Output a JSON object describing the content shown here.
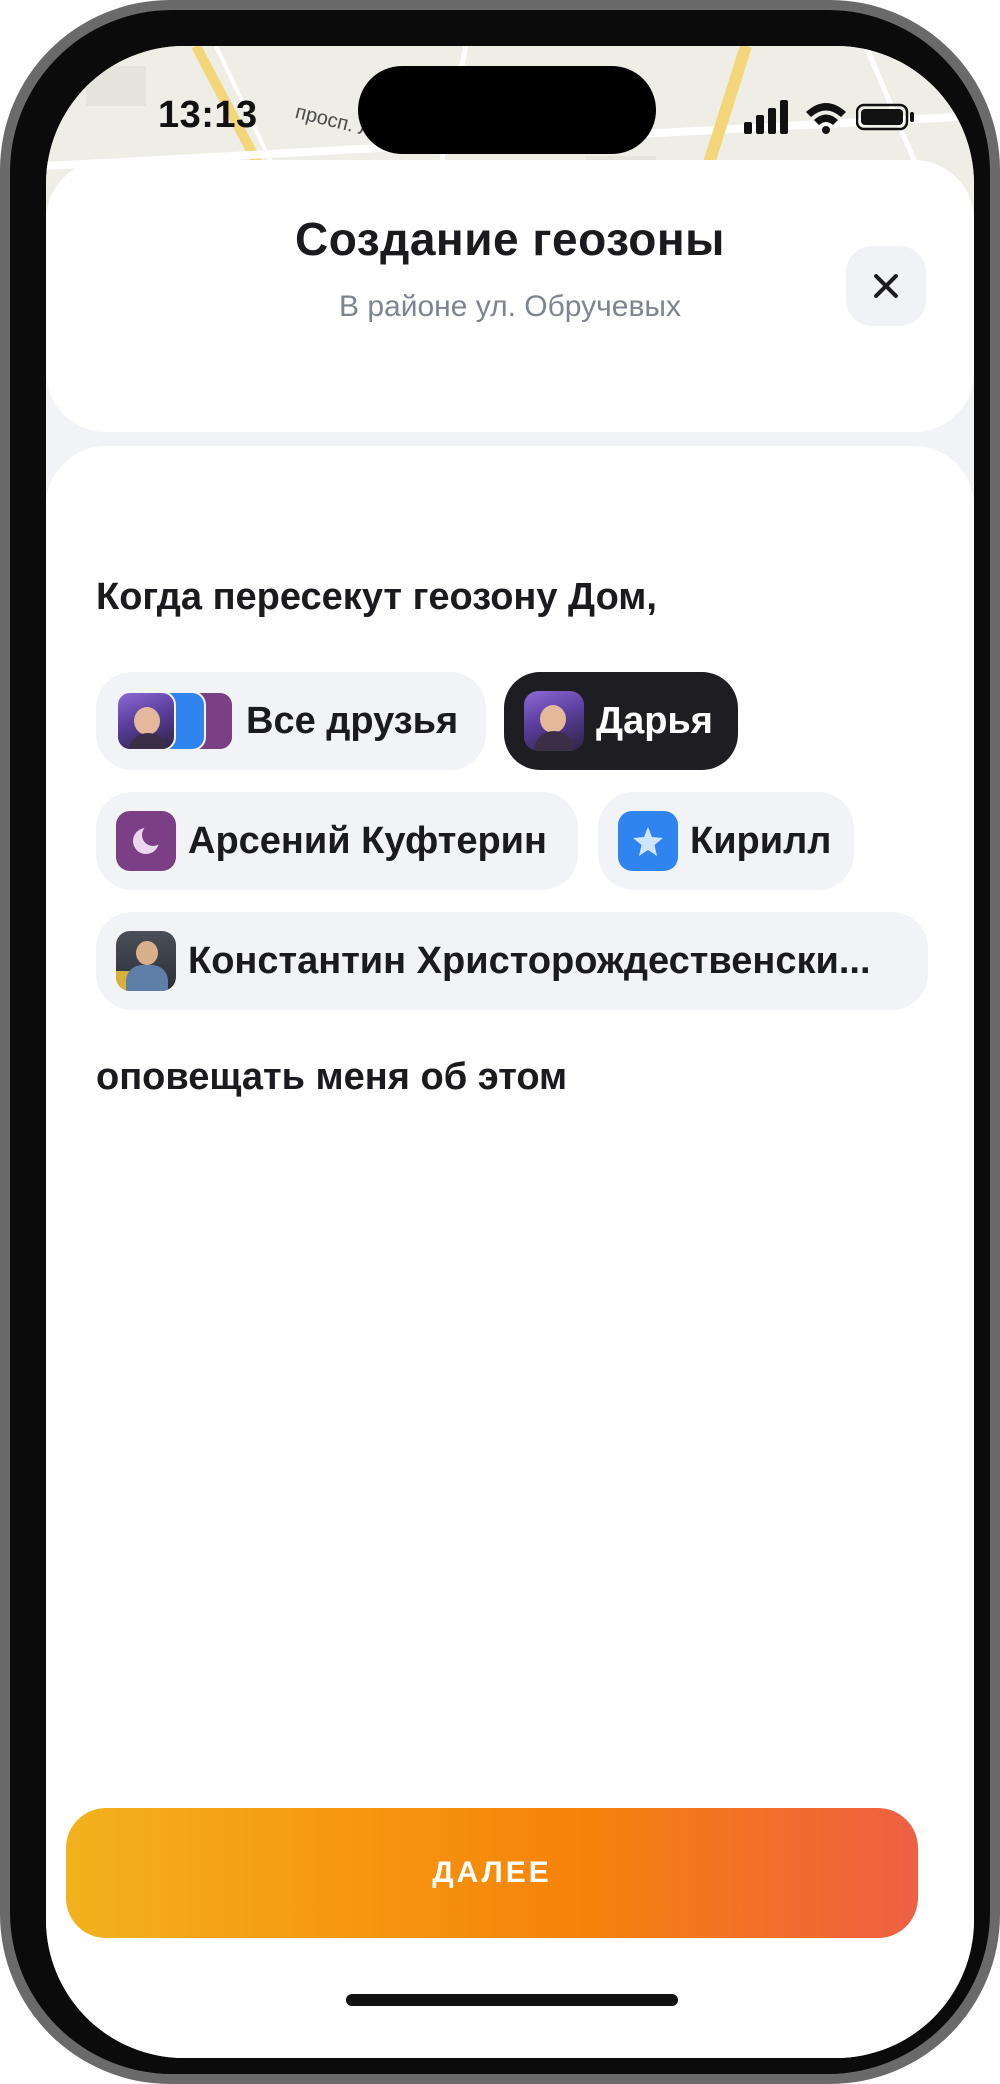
{
  "status_bar": {
    "time": "13:13",
    "icons": [
      "signal-icon",
      "wifi-icon",
      "battery-icon"
    ]
  },
  "map": {
    "street_label": "просп. Луна"
  },
  "header": {
    "title": "Создание геозоны",
    "subtitle": "В районе ул. Обручевых",
    "close_icon": "close-icon"
  },
  "body": {
    "lead": "Когда пересекут геозону Дом,",
    "tail": "оповещать меня об этом",
    "chips": [
      {
        "label": "Все друзья",
        "selected": false,
        "avatar": "group-avatar-stack"
      },
      {
        "label": "Дарья",
        "selected": true,
        "avatar": "photo-avatar"
      },
      {
        "label": "Арсений Куфтерин",
        "selected": false,
        "avatar": "moon-icon"
      },
      {
        "label": "Кирилл",
        "selected": false,
        "avatar": "star-icon"
      },
      {
        "label": "Константин Христорождественски...",
        "selected": false,
        "avatar": "photo-avatar"
      }
    ]
  },
  "footer": {
    "next_label": "ДАЛЕЕ"
  },
  "colors": {
    "selected_chip": "#1e1e22",
    "chip_bg": "#f2f3f7",
    "button_gradient_start": "#f2b21e",
    "button_gradient_end": "#ee5f44"
  }
}
